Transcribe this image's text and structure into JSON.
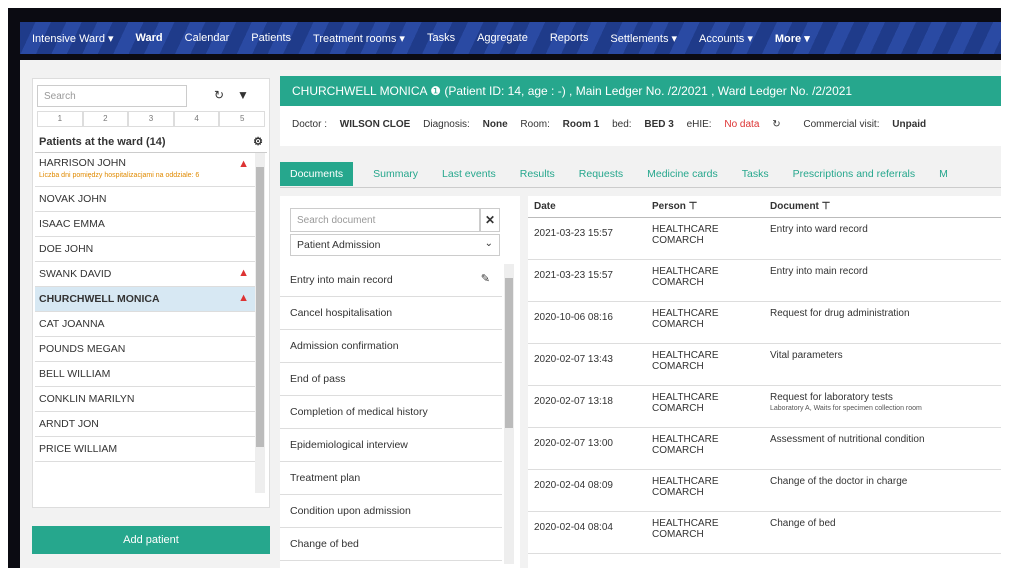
{
  "nav": [
    "Intensive Ward ▾",
    "Ward",
    "Calendar",
    "Patients",
    "Treatment rooms ▾",
    "Tasks",
    "Aggregate",
    "Reports",
    "Settlements ▾",
    "Accounts ▾",
    "More ▾"
  ],
  "left": {
    "search_placeholder": "Search",
    "pages": [
      "1",
      "2",
      "3",
      "4",
      "5"
    ],
    "ward_title": "Patients at the ward (14)",
    "patients": [
      {
        "name": "HARRISON JOHN",
        "sub": "Liczba dni pomiędzy hospitalizacjami na oddziale: 6",
        "warn": true
      },
      {
        "name": "NOVAK JOHN"
      },
      {
        "name": "ISAAC EMMA"
      },
      {
        "name": "DOE JOHN"
      },
      {
        "name": "SWANK DAVID",
        "warn": true
      },
      {
        "name": "CHURCHWELL MONICA",
        "warn": true,
        "selected": true
      },
      {
        "name": "CAT JOANNA"
      },
      {
        "name": "POUNDS MEGAN"
      },
      {
        "name": "BELL WILLIAM"
      },
      {
        "name": "CONKLIN MARILYN"
      },
      {
        "name": "ARNDT JON"
      },
      {
        "name": "PRICE WILLIAM"
      }
    ],
    "add_label": "Add patient"
  },
  "patient": {
    "banner": "CHURCHWELL MONICA ❶ (Patient ID: 14, age : -) , Main Ledger No. /2/2021 , Ward Ledger No. /2/2021",
    "doctor_label": "Doctor :",
    "doctor": "WILSON CLOE",
    "diagnosis_label": "Diagnosis:",
    "diagnosis": "None",
    "room_label": "Room:",
    "room": "Room 1",
    "bed_label": "bed:",
    "bed": "BED 3",
    "ehie_label": "eHIE:",
    "ehie": "No data",
    "visit_label": "Commercial visit:",
    "visit": "Unpaid"
  },
  "tabs": [
    "Documents",
    "Summary",
    "Last events",
    "Results",
    "Requests",
    "Medicine cards",
    "Tasks",
    "Prescriptions and referrals",
    "M"
  ],
  "docs": {
    "search_placeholder": "Search document",
    "category": "Patient Admission",
    "items": [
      "Entry into main record",
      "Cancel hospitalisation",
      "Admission confirmation",
      "End of pass",
      "Completion of medical history",
      "Epidemiological interview",
      "Treatment plan",
      "Condition upon admission",
      "Change of bed"
    ]
  },
  "table": {
    "headers": [
      "Date",
      "Person ⊤",
      "Document ⊤"
    ],
    "rows": [
      [
        "2021-03-23 15:57",
        "HEALTHCARE COMARCH",
        "Entry into ward record",
        ""
      ],
      [
        "2021-03-23 15:57",
        "HEALTHCARE COMARCH",
        "Entry into main record",
        ""
      ],
      [
        "2020-10-06 08:16",
        "HEALTHCARE COMARCH",
        "Request for drug administration",
        ""
      ],
      [
        "2020-02-07 13:43",
        "HEALTHCARE COMARCH",
        "Vital parameters",
        ""
      ],
      [
        "2020-02-07 13:18",
        "HEALTHCARE COMARCH",
        "Request for laboratory tests",
        "Laboratory A, Waits for specimen collection room"
      ],
      [
        "2020-02-07 13:00",
        "HEALTHCARE COMARCH",
        "Assessment of nutritional condition",
        ""
      ],
      [
        "2020-02-04 08:09",
        "HEALTHCARE COMARCH",
        "Change of the doctor in charge",
        ""
      ],
      [
        "2020-02-04 08:04",
        "HEALTHCARE COMARCH",
        "Change of bed",
        ""
      ]
    ]
  }
}
